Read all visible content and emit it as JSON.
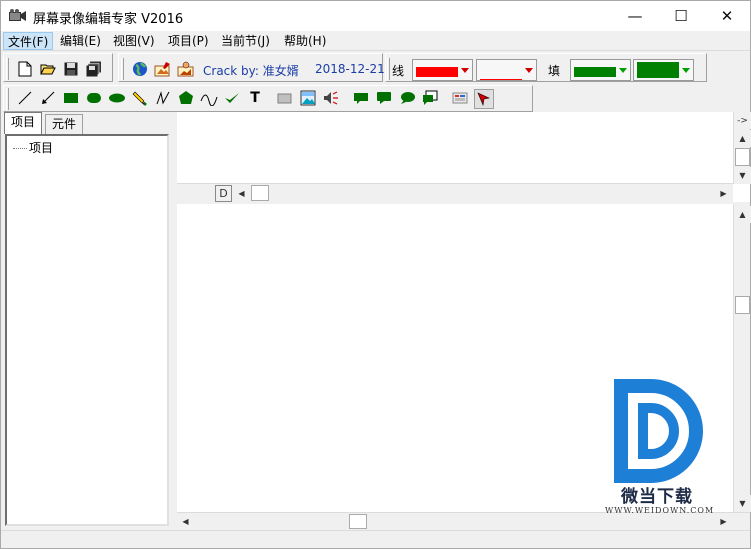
{
  "window": {
    "title": "屏幕录像编辑专家 V2016",
    "controls": {
      "minimize": "—",
      "maximize": "☐",
      "close": "✕"
    }
  },
  "menu": [
    {
      "label": "文件(F)",
      "active": true
    },
    {
      "label": "编辑(E)"
    },
    {
      "label": "视图(V)"
    },
    {
      "label": "项目(P)"
    },
    {
      "label": "当前节(J)"
    },
    {
      "label": "帮助(H)"
    }
  ],
  "toolbar": {
    "crack_label": "Crack by: 准女婿",
    "date": "2018-12-21",
    "line_label": "线",
    "fill_label": "填",
    "colors": {
      "line_color": "#ff0000",
      "line_style_color": "#ff0000",
      "fill_color": "#008000",
      "fill_color2": "#008000"
    },
    "text_tool": "T"
  },
  "left_panel": {
    "tabs": [
      "项目",
      "元件"
    ],
    "active_tab": "项目",
    "tree": [
      {
        "label": "项目"
      }
    ]
  },
  "top_pane": {
    "corner_button": "->",
    "hscroll_left_button": "D"
  },
  "watermark": {
    "brand": "微当下载",
    "url": "WWW.WEIDOWN.COM"
  }
}
